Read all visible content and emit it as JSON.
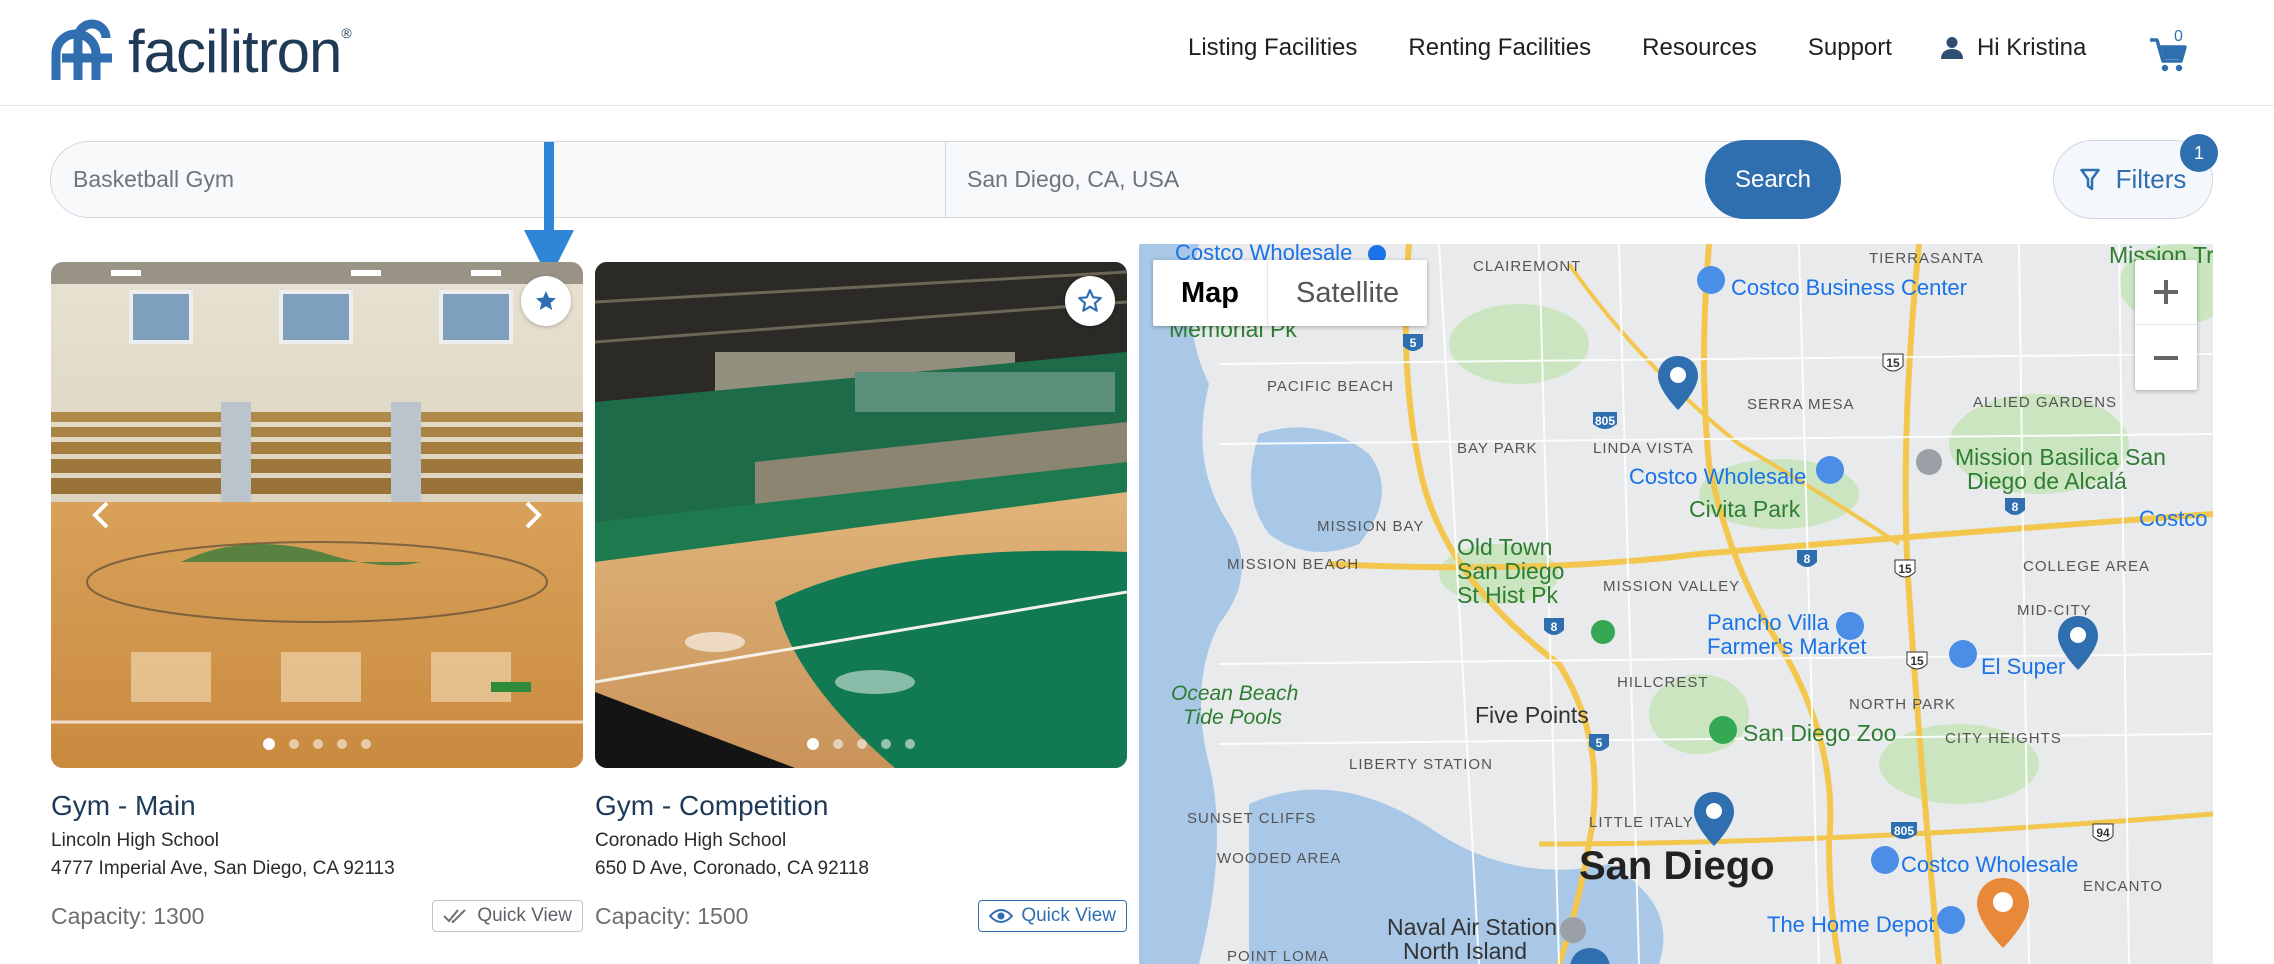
{
  "header": {
    "logo_text": "facilitron",
    "logo_reg": "®",
    "nav": [
      "Listing Facilities",
      "Renting Facilities",
      "Resources",
      "Support"
    ],
    "greeting": "Hi Kristina",
    "cart_count": "0",
    "icons": {
      "user": "person-icon",
      "cart": "cart-icon"
    }
  },
  "search": {
    "keyword": "Basketball Gym",
    "location": "San Diego, CA, USA",
    "button": "Search",
    "filters_label": "Filters",
    "filters_count": "1"
  },
  "cards": [
    {
      "title": "Gym - Main",
      "school": "Lincoln High School",
      "address": "4777 Imperial Ave, San Diego, CA 92113",
      "capacity": "Capacity: 1300",
      "quickview": "Quick View",
      "favorited": true,
      "slides": 5,
      "active_slide": 1
    },
    {
      "title": "Gym - Competition",
      "school": "Coronado High School",
      "address": "650 D Ave, Coronado, CA 92118",
      "capacity": "Capacity: 1500",
      "quickview": "Quick View",
      "favorited": false,
      "slides": 5,
      "active_slide": 1
    }
  ],
  "map": {
    "toggle": [
      "Map",
      "Satellite"
    ],
    "selected": "Map",
    "labels": {
      "costco_wholesale_top": "Costco Wholesale",
      "clairemont": "CLAIREMONT",
      "tierrasanta": "TIERRASANTA",
      "mission_trails": "Mission Trails",
      "costco_business": "Costco Business Center",
      "memorial_pk": "Memorial Pk",
      "pacific_beach": "PACIFIC BEACH",
      "serra_mesa": "SERRA MESA",
      "allied_gardens": "ALLIED GARDENS",
      "bay_park": "BAY PARK",
      "linda_vista": "LINDA VISTA",
      "costco_wholesale_mid": "Costco Wholesale",
      "mission_basilica": "Mission Basilica San",
      "diego_de_alcala": "Diego de Alcalá",
      "civita_park": "Civita Park",
      "mission_bay": "MISSION BAY",
      "costco_wh_right": "Costco Wh",
      "mission_beach": "MISSION BEACH",
      "old_town": "Old Town",
      "san_diego_st_hist": "San Diego",
      "st_hist_pk": "St Hist Pk",
      "mission_valley": "MISSION VALLEY",
      "college_area": "COLLEGE AREA",
      "mid_city": "MID-CITY",
      "pancho_villa": "Pancho Villa",
      "farmers_market": "Farmer's Market",
      "el_super": "El Super",
      "ocean_beach": "Ocean Beach",
      "tide_pools": "Tide Pools",
      "hillcrest": "HILLCREST",
      "north_park": "NORTH PARK",
      "five_points": "Five Points",
      "san_diego_zoo": "San Diego Zoo",
      "city_heights": "CITY HEIGHTS",
      "liberty_station": "LIBERTY STATION",
      "sunset_cliffs": "SUNSET CLIFFS",
      "little_italy": "LITTLE ITALY",
      "costco_wholesale_bottom": "Costco Wholesale",
      "wooded_area": "WOODED AREA",
      "san_diego": "San Diego",
      "encanto": "ENCANTO",
      "naval_air_station": "Naval Air Station",
      "north_island": "North Island",
      "home_depot": "The Home Depot",
      "point_loma": "POINT LOMA"
    },
    "highway_shields": [
      "5",
      "805",
      "15",
      "8",
      "8",
      "8",
      "15",
      "15",
      "5",
      "805",
      "94"
    ]
  },
  "colors": {
    "brand_blue": "#2f6fb0",
    "title_navy": "#1f3a57",
    "map_pin_blue": "#2f6fb0",
    "map_pin_orange": "#e8893a"
  }
}
